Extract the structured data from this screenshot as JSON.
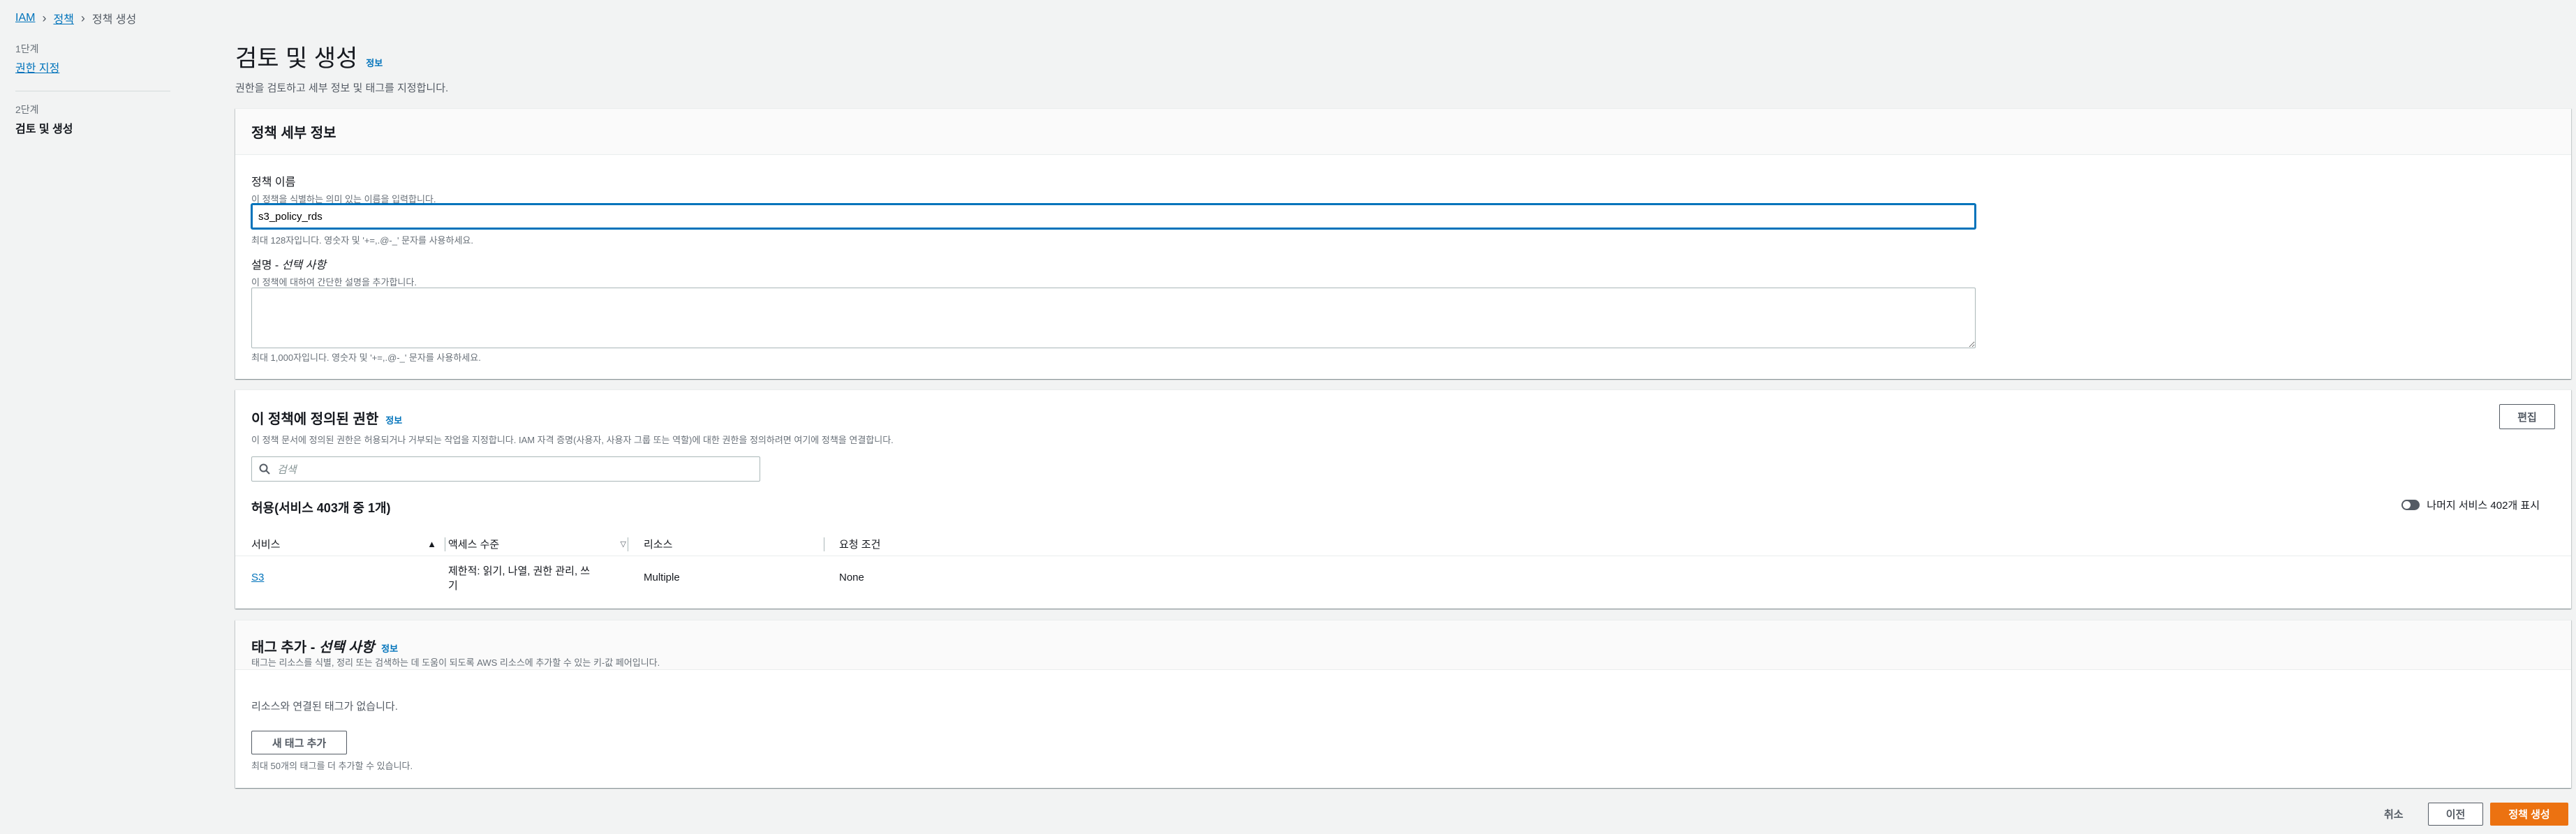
{
  "breadcrumb": {
    "root": "IAM",
    "parent": "정책",
    "current": "정책 생성"
  },
  "steps": [
    {
      "num": "1단계",
      "title": "권한 지정"
    },
    {
      "num": "2단계",
      "title": "검토 및 생성"
    }
  ],
  "page": {
    "title": "검토 및 생성",
    "info": "정보",
    "description": "권한을 검토하고 세부 정보 및 태그를 지정합니다."
  },
  "policy_details": {
    "title": "정책 세부 정보",
    "name_label": "정책 이름",
    "name_hint": "이 정책을 식별하는 의미 있는 이름을 입력합니다.",
    "name_value": "s3_policy_rds",
    "name_constraint": "최대 128자입니다. 영숫자 및 '+=,.@-_' 문자를 사용하세요.",
    "desc_label": "설명 - ",
    "desc_label_optional": "선택 사항",
    "desc_hint": "이 정책에 대하여 간단한 설명을 추가합니다.",
    "desc_value": "",
    "desc_constraint": "최대 1,000자입니다. 영숫자 및 '+=,.@-_' 문자를 사용하세요."
  },
  "permissions": {
    "title": "이 정책에 정의된 권한",
    "info": "정보",
    "description": "이 정책 문서에 정의된 권한은 허용되거나 거부되는 작업을 지정합니다. IAM 자격 증명(사용자, 사용자 그룹 또는 역할)에 대한 권한을 정의하려면 여기에 정책을 연결합니다.",
    "edit_label": "편집",
    "search_placeholder": "검색",
    "allow_heading": "허용(서비스 403개 중 1개)",
    "toggle_label": "나머지 서비스 402개 표시",
    "columns": [
      "서비스",
      "액세스 수준",
      "리소스",
      "요청 조건"
    ],
    "rows": [
      {
        "service": "S3",
        "access_line1": "제한적: 읽기, 나열, 권한 관리, 쓰",
        "access_line2": "기",
        "resource": "Multiple",
        "condition": "None"
      }
    ]
  },
  "tags": {
    "title": "태그 추가 - ",
    "title_optional": "선택 사항",
    "info": "정보",
    "description": "태그는 리소스를 식별, 정리 또는 검색하는 데 도움이 되도록 AWS 리소스에 추가할 수 있는 키-값 페어입니다.",
    "empty": "리소스와 연결된 태그가 없습니다.",
    "add_label": "새 태그 추가",
    "limit": "최대 50개의 태그를 더 추가할 수 있습니다."
  },
  "footer": {
    "cancel": "취소",
    "previous": "이전",
    "create": "정책 생성"
  }
}
